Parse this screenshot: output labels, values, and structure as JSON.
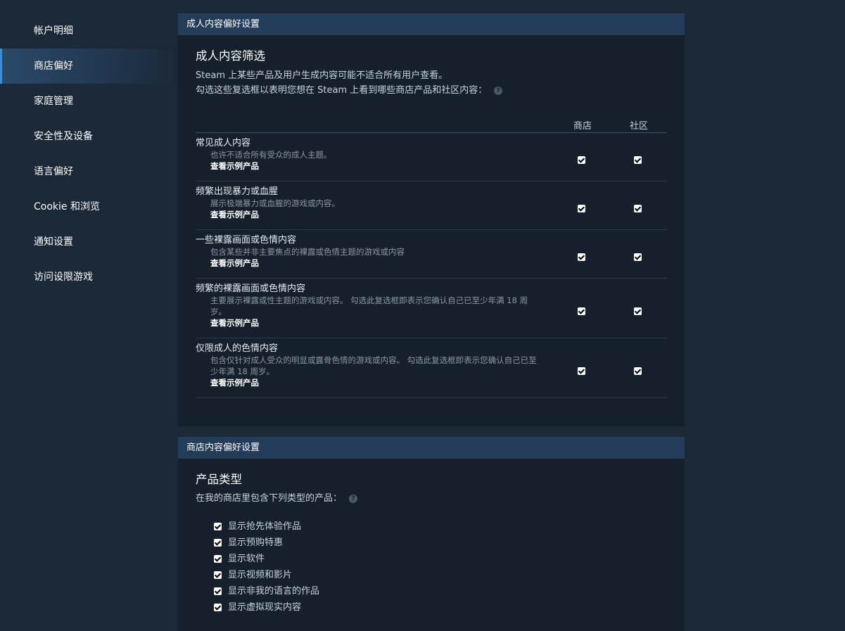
{
  "sidebar": {
    "items": [
      {
        "label": "帐户明细"
      },
      {
        "label": "商店偏好"
      },
      {
        "label": "家庭管理"
      },
      {
        "label": "安全性及设备"
      },
      {
        "label": "语言偏好"
      },
      {
        "label": "Cookie 和浏览"
      },
      {
        "label": "通知设置"
      },
      {
        "label": "访问设限游戏"
      }
    ],
    "active_index": 1
  },
  "adult": {
    "header": "成人内容偏好设置",
    "title": "成人内容筛选",
    "desc1": "Steam 上某些产品及用户生成内容可能不适合所有用户查看。",
    "desc2": "勾选这些复选框以表明您想在 Steam 上看到哪些商店产品和社区内容：",
    "col_store": "商店",
    "col_community": "社区",
    "rows": [
      {
        "title": "常见成人内容",
        "desc": "也许不适合所有受众的成人主题。",
        "link": "查看示例产品",
        "store": true,
        "community": true
      },
      {
        "title": "频繁出现暴力或血腥",
        "desc": "展示极端暴力或血腥的游戏或内容。",
        "link": "查看示例产品",
        "store": true,
        "community": true
      },
      {
        "title": "一些裸露画面或色情内容",
        "desc": "包含某些并非主要焦点的裸露或色情主题的游戏或内容",
        "link": "查看示例产品",
        "store": true,
        "community": true
      },
      {
        "title": "频繁的裸露画面或色情内容",
        "desc": "主要展示裸露或性主题的游戏或内容。 勾选此复选框即表示您确认自己已至少年满 18 周岁。",
        "link": "查看示例产品",
        "store": true,
        "community": true
      },
      {
        "title": "仅限成人的色情内容",
        "desc": "包含仅针对成人受众的明显或露骨色情的游戏或内容。 勾选此复选框即表示您确认自己已至少年满 18 周岁。",
        "link": "查看示例产品",
        "store": true,
        "community": true
      }
    ]
  },
  "store": {
    "header": "商店内容偏好设置",
    "title": "产品类型",
    "desc": "在我的商店里包含下列类型的产品：",
    "types": [
      {
        "label": "显示抢先体验作品",
        "checked": true
      },
      {
        "label": "显示预购特惠",
        "checked": true
      },
      {
        "label": "显示软件",
        "checked": true
      },
      {
        "label": "显示视频和影片",
        "checked": true
      },
      {
        "label": "显示非我的语言的作品",
        "checked": true
      },
      {
        "label": "显示虚拟现实内容",
        "checked": true
      }
    ]
  },
  "help_icon_glyph": "?",
  "colors": {
    "page_bg": "#1b2838",
    "panel_bg": "#16202d",
    "header_bg": "#233c5a",
    "active_accent": "#3a8fd8"
  }
}
